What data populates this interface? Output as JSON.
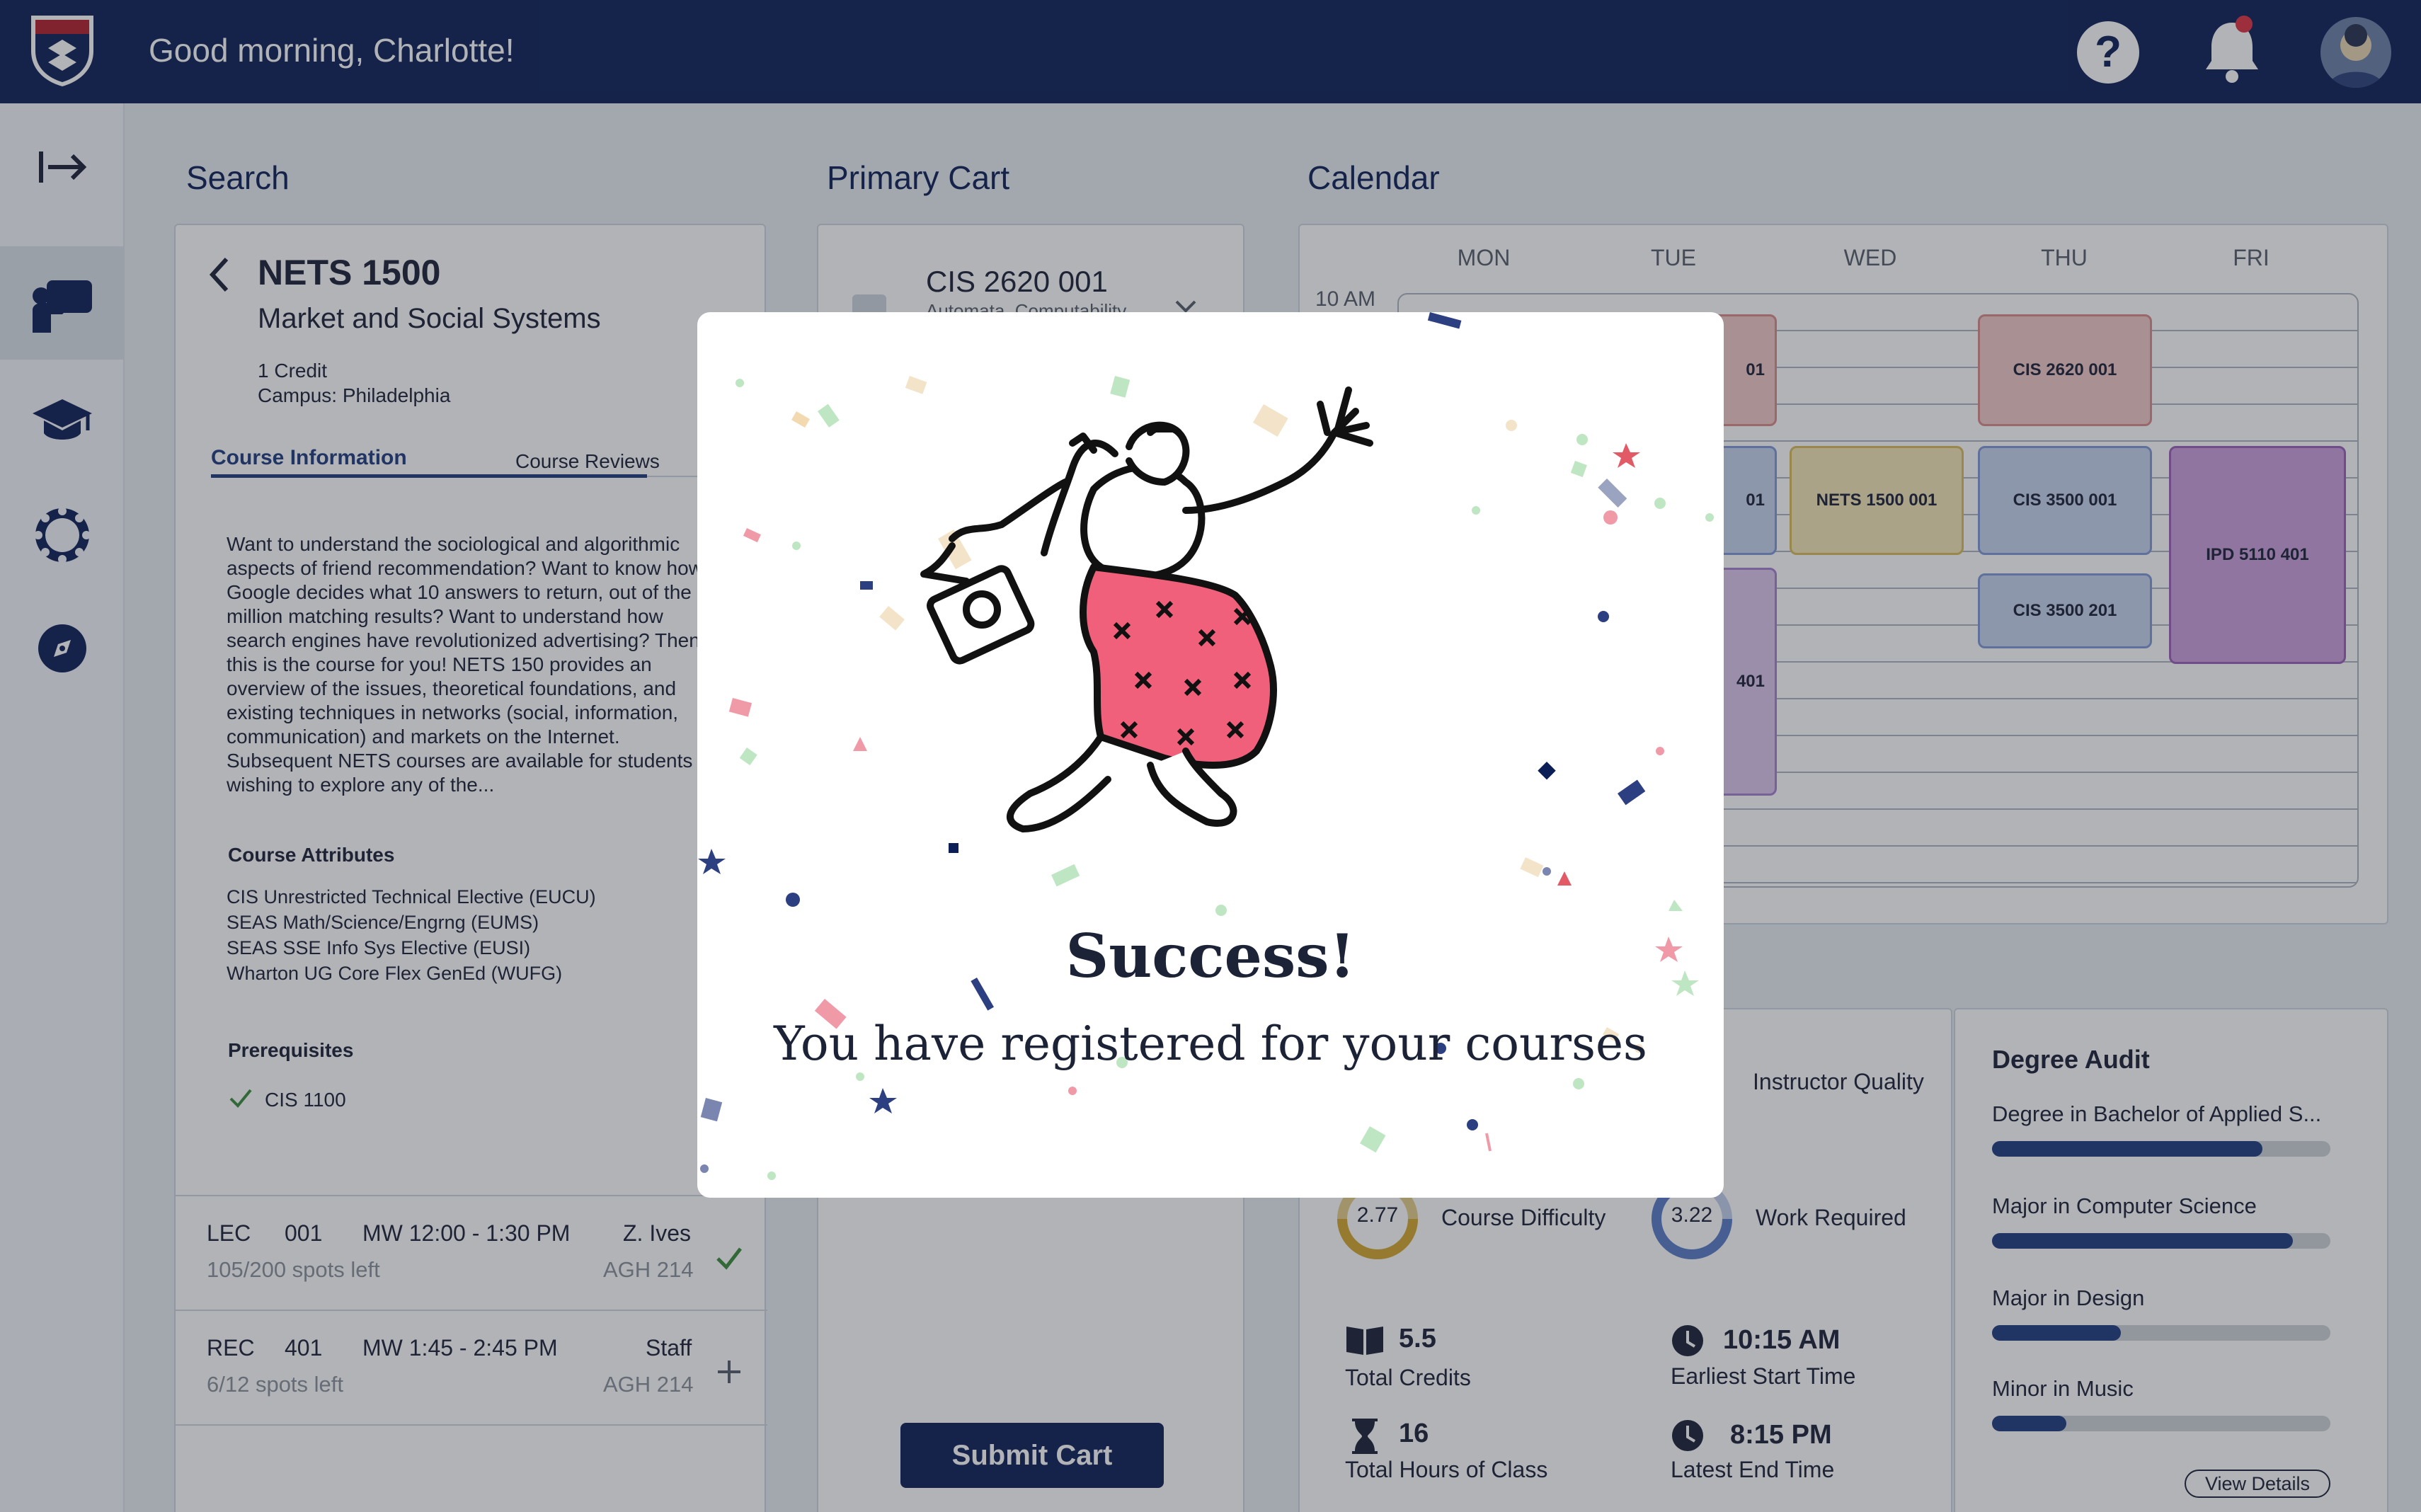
{
  "header": {
    "greeting": "Good morning, Charlotte!",
    "help_label": "?"
  },
  "colors": {
    "navy": "#0b1f56",
    "accent_red": "#e15a66",
    "pink": "#f0607a"
  },
  "sidebar": {
    "items": [
      "expand-icon",
      "tutor-icon",
      "graduation-cap-icon",
      "gear-icon",
      "compass-icon"
    ]
  },
  "search": {
    "section_title": "Search",
    "course_code": "NETS 1500",
    "course_name": "Market and Social Systems",
    "credits": "1 Credit",
    "campus": "Campus: Philadelphia",
    "tabs": [
      "Course Information",
      "Course Reviews"
    ],
    "description": "Want to understand the sociological and algorithmic aspects of friend recommendation? Want to know how Google decides what 10 answers to return, out of the 10 million matching results? Want to understand how search engines have revolutionized advertising? Then this is the course for you! NETS 150 provides an overview of the issues, theoretical foundations, and existing techniques in networks (social, information, communication) and markets on the Internet. Subsequent NETS courses are available for students wishing to explore any of the...",
    "attributes_title": "Course Attributes",
    "attributes": [
      "CIS Unrestricted Technical Elective (EUCU)",
      "SEAS Math/Science/Engrng (EUMS)",
      "SEAS SSE Info Sys Elective (EUSI)",
      "Wharton UG Core Flex GenEd (WUFG)"
    ],
    "prereq_title": "Prerequisites",
    "prereq": "CIS 1100",
    "sections": [
      {
        "type": "LEC",
        "num": "001",
        "time": "MW 12:00 - 1:30 PM",
        "instructor": "Z. Ives",
        "spots": "105/200 spots left",
        "room": "AGH 214",
        "action": "check"
      },
      {
        "type": "REC",
        "num": "401",
        "time": "MW 1:45 - 2:45 PM",
        "instructor": "Staff",
        "spots": "6/12 spots left",
        "room": "AGH 214",
        "action": "add"
      }
    ]
  },
  "cart": {
    "section_title": "Primary Cart",
    "item_code": "CIS 2620 001",
    "item_name": "Automata, Computability",
    "submit_label": "Submit Cart"
  },
  "calendar": {
    "section_title": "Calendar",
    "days": [
      "MON",
      "TUE",
      "WED",
      "THU",
      "FRI"
    ],
    "time_label": "10 AM",
    "events": [
      "CIS 2620 001",
      "NETS 1500 001",
      "CIS 3500 001",
      "CIS 3500 201",
      "IPD 5110 401",
      "01",
      "01",
      "401"
    ]
  },
  "stats": {
    "instructor_quality_label": "Instructor Quality",
    "course_difficulty": "2.77",
    "course_difficulty_label": "Course Difficulty",
    "work_required": "3.22",
    "work_required_label": "Work Required",
    "total_credits": "5.5",
    "total_credits_label": "Total Credits",
    "earliest_start": "10:15 AM",
    "earliest_start_label": "Earliest Start Time",
    "total_hours": "16",
    "total_hours_label": "Total Hours of Class",
    "latest_end": "8:15 PM",
    "latest_end_label": "Latest End Time"
  },
  "degree_audit": {
    "title": "Degree Audit",
    "items": [
      {
        "label": "Degree in Bachelor of Applied S...",
        "progress": 0.8
      },
      {
        "label": "Major in Computer Science",
        "progress": 0.89
      },
      {
        "label": "Major in Design",
        "progress": 0.38
      },
      {
        "label": "Minor in Music",
        "progress": 0.22
      }
    ],
    "view_details_label": "View Details"
  },
  "modal": {
    "title": "Success!",
    "message": "You have registered for your courses"
  }
}
